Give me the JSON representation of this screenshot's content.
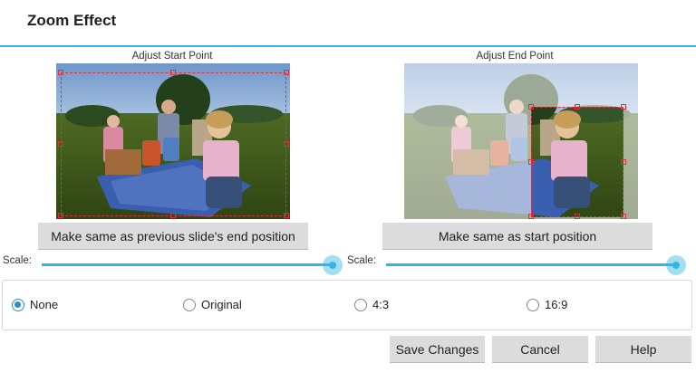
{
  "dialog": {
    "title": "Zoom Effect"
  },
  "start_panel": {
    "label": "Adjust Start Point",
    "button": "Make same as previous slide's end position",
    "scale_label": "Scale:",
    "scale_value": 1.0
  },
  "end_panel": {
    "label": "Adjust End Point",
    "button": "Make same as start position",
    "scale_label": "Scale:",
    "scale_value": 1.0
  },
  "aspect_options": [
    {
      "label": "None",
      "selected": true
    },
    {
      "label": "Original",
      "selected": false
    },
    {
      "label": "4:3",
      "selected": false
    },
    {
      "label": "16:9",
      "selected": false
    }
  ],
  "actions": {
    "save": "Save Changes",
    "cancel": "Cancel",
    "help": "Help"
  },
  "colors": {
    "accent": "#33b5e5",
    "crop": "#e03040"
  }
}
